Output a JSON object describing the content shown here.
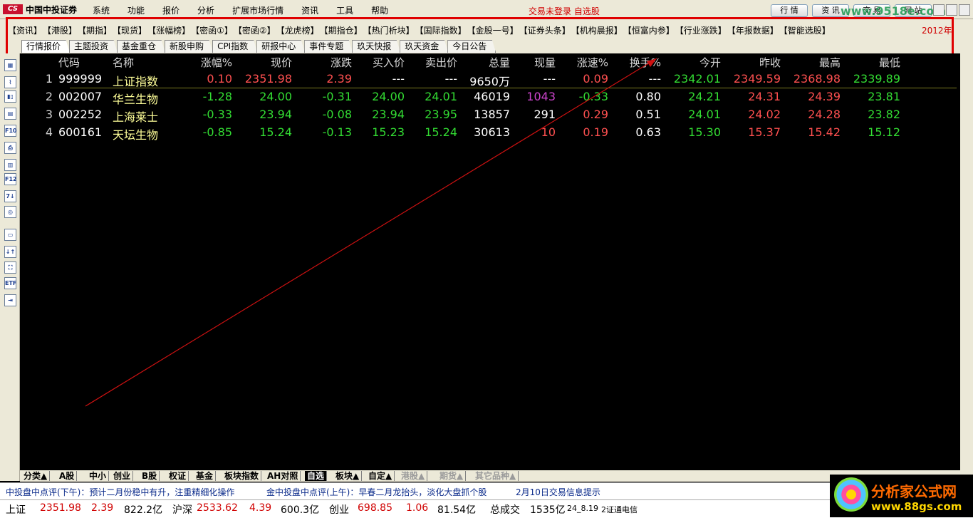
{
  "app": {
    "logo_mark": "CS",
    "brand": "中国中投证券",
    "menus": [
      "系统",
      "功能",
      "报价",
      "分析",
      "扩展市场行情",
      "资讯",
      "工具",
      "帮助"
    ],
    "login_status": "交易未登录 自选股",
    "top_buttons": [
      "行 情",
      "资 讯",
      "交 易",
      "网 站"
    ],
    "watermark_top": "www.9518e.com"
  },
  "linkbar": {
    "links": [
      "【资讯】",
      "【港股】",
      "【期指】",
      "【现货】",
      "【涨幅榜】",
      "【密函①】",
      "【密函②】",
      "【龙虎榜】",
      "【期指仓】",
      "【热门析块】",
      "【国际指数】",
      "【金股一号】",
      "【证券头条】",
      "【机构晨报】",
      "【恒富内参】",
      "【行业涨跌】",
      "【年报数据】",
      "【智能选股】"
    ],
    "year": "2012年"
  },
  "tabs": [
    "行情报价",
    "主题投资",
    "基金重仓",
    "新股申购",
    "CPI指数",
    "研报中心",
    "事件专题",
    "玖天快报",
    "玖天资金",
    "今日公告"
  ],
  "left_tools": [
    "▦",
    "⌇",
    "▮▯",
    "▤",
    "F10",
    "⎙",
    "▥",
    "F12",
    "7↓",
    "◎",
    "▭",
    "↓↑",
    "⛶",
    "ETF",
    "⇥"
  ],
  "table": {
    "headers": [
      "代码",
      "名称",
      "涨幅%",
      "现价",
      "涨跌",
      "买入价",
      "卖出价",
      "总量",
      "现量",
      "涨速%",
      "换手%",
      "今开",
      "昨收",
      "最高",
      "最低"
    ],
    "rows": [
      {
        "idx": "1",
        "code": "999999",
        "name": "上证指数",
        "chg_pct": "0.10",
        "price": "2351.98",
        "chg": "2.39",
        "bid": "---",
        "ask": "---",
        "volume": "9650万",
        "cur_vol": "---",
        "speed": "0.09",
        "turnover": "---",
        "open": "2342.01",
        "prev": "2349.59",
        "high": "2368.98",
        "low": "2339.89"
      },
      {
        "idx": "2",
        "code": "002007",
        "name": "华兰生物",
        "chg_pct": "-1.28",
        "price": "24.00",
        "chg": "-0.31",
        "bid": "24.00",
        "ask": "24.01",
        "volume": "46019",
        "cur_vol": "1043",
        "speed": "-0.33",
        "turnover": "0.80",
        "open": "24.21",
        "prev": "24.31",
        "high": "24.39",
        "low": "23.81"
      },
      {
        "idx": "3",
        "code": "002252",
        "name": "上海莱士",
        "chg_pct": "-0.33",
        "price": "23.94",
        "chg": "-0.08",
        "bid": "23.94",
        "ask": "23.95",
        "volume": "13857",
        "cur_vol": "291",
        "speed": "0.29",
        "turnover": "0.51",
        "open": "24.01",
        "prev": "24.02",
        "high": "24.28",
        "low": "23.82"
      },
      {
        "idx": "4",
        "code": "600161",
        "name": "天坛生物",
        "chg_pct": "-0.85",
        "price": "15.24",
        "chg": "-0.13",
        "bid": "15.23",
        "ask": "15.24",
        "volume": "30613",
        "cur_vol": "10",
        "speed": "0.19",
        "turnover": "0.63",
        "open": "15.30",
        "prev": "15.37",
        "high": "15.42",
        "low": "15.12"
      }
    ],
    "colors": {
      "up": "#ff5050",
      "down": "#33dd33",
      "neutral": "#ffffff",
      "name": "#ffff99",
      "purple": "#cc44cc",
      "code": "#ffffff"
    }
  },
  "bottom_tabs": [
    "分类▲",
    "A股",
    "中小",
    "创业",
    "B股",
    "权证",
    "基金",
    "板块指数",
    "AH对照",
    "自选",
    "板块▲",
    "自定▲",
    "港股▲",
    "期货▲",
    "其它品种▲"
  ],
  "news": {
    "item1": "中投盘中点评(下午)：预计二月份稳中有升，注重精细化操作",
    "item2": "金中投盘中点评(上午)：早春二月龙抬头，淡化大盘抓个股",
    "item3": "2月10日交易信息提示"
  },
  "status": {
    "sh_label": "上证",
    "sh_val": "2351.98",
    "sh_chg": "2.39",
    "sh_amt": "822.2亿",
    "hs_label": "沪深",
    "hs_val": "2533.62",
    "hs_chg": "4.39",
    "hs_amt": "600.3亿",
    "cy_label": "创业",
    "cy_val": "698.85",
    "cy_chg": "1.06",
    "cy_amt": "81.54亿",
    "total_label": "总成交",
    "total_amt": "1535亿",
    "time": "24_8.19",
    "net": "2证通电信"
  },
  "watermark_bottom": {
    "title": "分析家公式网",
    "url": "www.88gs.com"
  }
}
